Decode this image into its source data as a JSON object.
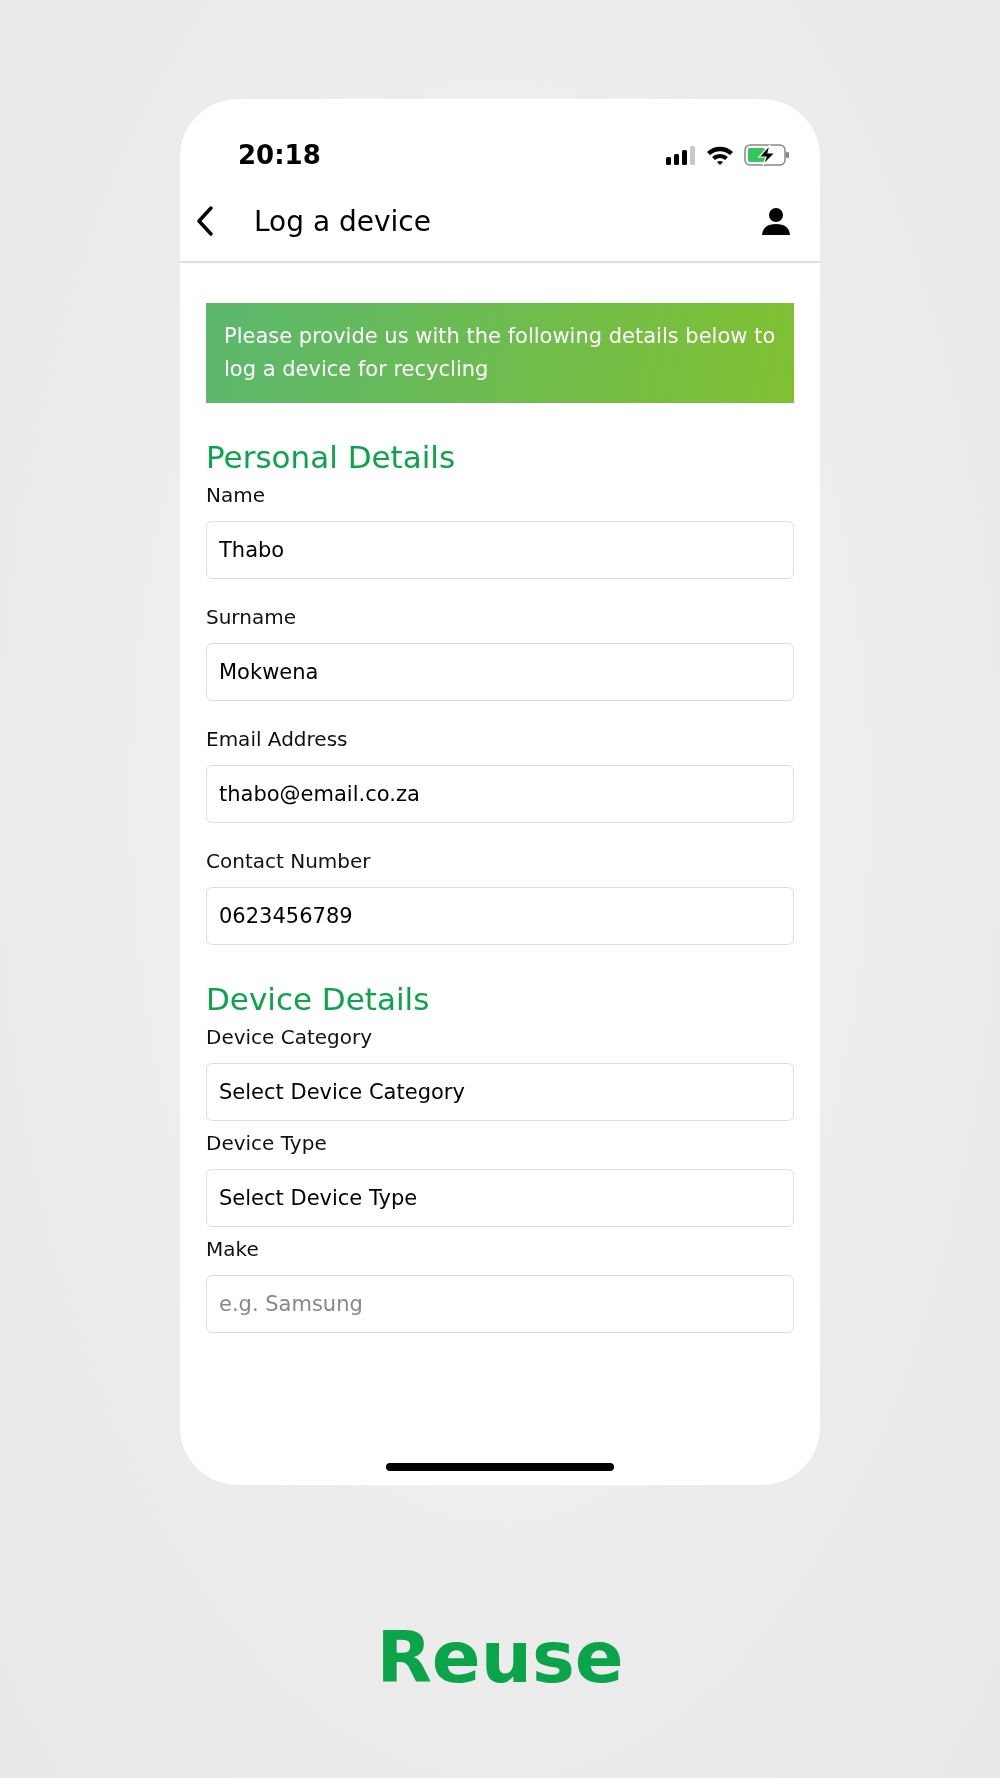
{
  "status_bar": {
    "time": "20:18"
  },
  "header": {
    "title": "Log a device"
  },
  "banner": {
    "text": "Please provide us with the following details below to log a device for recycling"
  },
  "sections": [
    {
      "title": "Personal Details",
      "fields": [
        {
          "label": "Name",
          "value": "Thabo"
        },
        {
          "label": "Surname",
          "value": "Mokwena"
        },
        {
          "label": "Email Address",
          "value": "thabo@email.co.za"
        },
        {
          "label": "Contact Number",
          "value": "0623456789"
        }
      ]
    },
    {
      "title": "Device Details",
      "fields": [
        {
          "label": "Device Category",
          "value": "Select Device Category"
        },
        {
          "label": "Device Type",
          "value": "Select Device Type"
        },
        {
          "label": "Make",
          "placeholder": "e.g. Samsung"
        }
      ]
    }
  ],
  "caption": "Reuse"
}
